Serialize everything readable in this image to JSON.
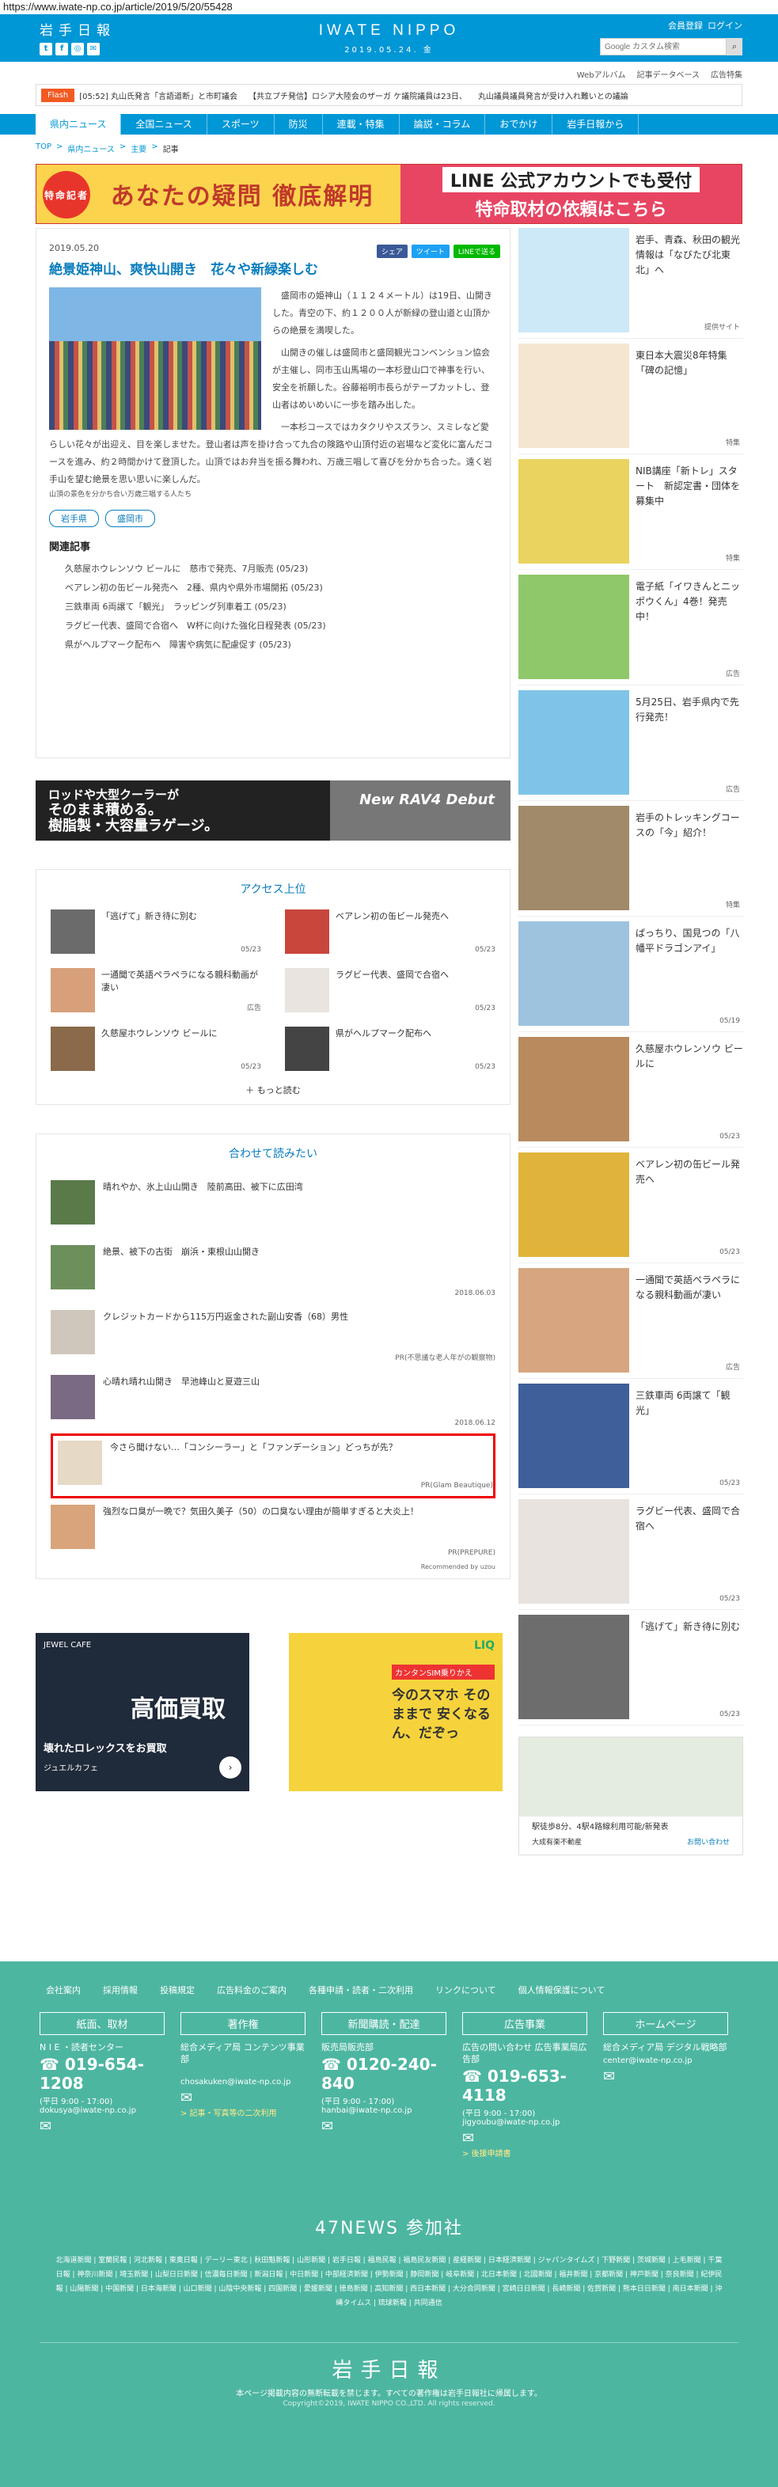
{
  "url": "https://www.iwate-np.co.jp/article/2019/5/20/55428",
  "header": {
    "logo": "岩手日報",
    "brand": "IWATE NIPPO",
    "date": "2019.05.24. 金",
    "register": "会員登録",
    "login": "ログイン",
    "search_placeholder": "Google カスタム検索",
    "social": [
      "t",
      "f",
      "◎",
      "✉"
    ]
  },
  "subnav": [
    "Webアルバム",
    "記事データベース",
    "広告特集"
  ],
  "flash": {
    "badge": "Flash",
    "items": [
      "[05:52] 丸山氏発言「言語道断」と市町議会",
      "【共立プチ発信】ロシア大陸会のザーガ ケ議院議員は23日、",
      "丸山議員議員発言が受け入れ難いとの議論"
    ]
  },
  "gnav": [
    "県内ニュース",
    "全国ニュース",
    "スポーツ",
    "防災",
    "連載・特集",
    "論説・コラム",
    "おでかけ",
    "岩手日報から"
  ],
  "breadcrumb": [
    "TOP",
    "県内ニュース",
    "主要",
    "記事"
  ],
  "banner": {
    "tag": "特命記者",
    "title": "あなたの疑問 徹底解明",
    "line1": "LINE 公式アカウントでも受付",
    "line2": "特命取材の依頼はこちら"
  },
  "article": {
    "date": "2019.05.20",
    "share": [
      "シェア",
      "ツイート",
      "LINEで送る"
    ],
    "title": "絶景姫神山、爽快山開き　花々や新緑楽しむ",
    "caption": "山頂の景色を分かち合い万歳三唱する人たち",
    "paragraphs": [
      "盛岡市の姫神山（１１２４メートル）は19日、山開きした。青空の下、約１２００人が新緑の登山道と山頂からの絶景を満喫した。",
      "山開きの催しは盛岡市と盛岡観光コンベンション協会が主催し、同市玉山馬場の一本杉登山口で神事を行い、安全を祈願した。谷藤裕明市長らがテープカットし、登山者はめいめいに一歩を踏み出した。",
      "一本杉コースではカタクリやスズラン、スミレなど愛らしい花々が出迎え、目を楽しませた。登山者は声を掛け合って九合の険路や山頂付近の岩場など変化に富んだコースを進み、約２時間かけて登頂した。山頂ではお弁当を振る舞われ、万歳三唱して喜びを分かち合った。遠く岩手山を望む絶景を思い思いに楽しんだ。"
    ],
    "tags": [
      "岩手県",
      "盛岡市"
    ],
    "related_title": "関連記事",
    "related": [
      "久慈屋ホウレンソウ ビールに　慈市で発売、7月販売 (05/23)",
      "ベアレン初の缶ビール発売へ　2種、県内や県外市場開拓 (05/23)",
      "三鉄車両 6両譲て「観光」　ラッピング列車着工 (05/23)",
      "ラグビー代表、盛岡で合宿へ　W杯に向けた強化日程発表 (05/23)",
      "県がヘルプマーク配布へ　障害や病気に配慮促す (05/23)"
    ]
  },
  "adwide": {
    "text1": "ロッドや大型クーラーが",
    "text2": "そのまま積める。",
    "text3": "樹脂製・大容量ラゲージ。",
    "brand": "New RAV4 Debut"
  },
  "ranking": {
    "title": "アクセス上位",
    "items": [
      {
        "title": "「逃げて」新き待に別む",
        "meta": "05/23"
      },
      {
        "title": "ベアレン初の缶ビール発売へ",
        "meta": "05/23"
      },
      {
        "title": "一通聞で英語ペラペラになる親科動画が凄い",
        "meta": "広告"
      },
      {
        "title": "ラグビー代表、盛岡で合宿へ",
        "meta": "05/23"
      },
      {
        "title": "久慈屋ホウレンソウ ビールに",
        "meta": "05/23"
      },
      {
        "title": "県がヘルプマーク配布へ",
        "meta": "05/23"
      }
    ],
    "more": "もっと読む"
  },
  "also": {
    "title": "合わせて読みたい",
    "items": [
      {
        "title": "晴れやか、氷上山山開き　陸前高田、被下に広田湾",
        "meta": ""
      },
      {
        "title": "絶景、被下の古街　崩浜・東根山山開き",
        "meta": "2018.06.03"
      },
      {
        "title": "クレジットカードから115万円返金された副山安香（68）男性",
        "meta": "PR(不思議な老人年がの観察物)"
      },
      {
        "title": "心晴れ晴れ山開き　早池峰山と夏遊三山",
        "meta": "2018.06.12"
      },
      {
        "title": "今さら聞けない…「コンシーラー」と「ファンデーション」どっちが先？",
        "meta": "PR(Glam Beautique)"
      },
      {
        "title": "強烈な口臭が一晩で？気田久美子（50）の口臭ない理由が簡単すぎると大炎上！",
        "meta": "PR(PREPURE)"
      }
    ],
    "powered": "Recommended by uzou"
  },
  "bottom_ads": [
    {
      "t1": "JEWEL CAFE",
      "t2": "高価買取",
      "t3": "壊れたロレックスをお買取",
      "t4": "ジュエルカフェ"
    },
    {
      "t1": "カンタンSIM乗りかえ",
      "t2": "今のスマホ そのままで 安くなるん、だぞっ",
      "t3": "LIQ"
    }
  ],
  "side": [
    {
      "title": "岩手、青森、秋田の観光情報は「なびたび北東北」へ",
      "meta": "提供サイト"
    },
    {
      "title": "東日本大震災8年特集「碑の記憶」",
      "meta": "特集"
    },
    {
      "title": "NIB講座「新トレ」スタート　新認定書・団体を募集中",
      "meta": "特集"
    },
    {
      "title": "電子紙「イワきんとニッポウくん」4巻！発売中！",
      "meta": "広告"
    },
    {
      "title": "5月25日、岩手県内で先行発売！",
      "meta": "広告"
    },
    {
      "title": "岩手のトレッキングコースの「今」紹介！",
      "meta": "特集"
    },
    {
      "title": "ぱっちり、国見つの「八幡平ドラゴンアイ」",
      "meta": "05/19"
    },
    {
      "title": "久慈屋ホウレンソウ ビールに",
      "meta": "05/23"
    },
    {
      "title": "ベアレン初の缶ビール発売へ",
      "meta": "05/23"
    },
    {
      "title": "一通聞で英語ペラペラになる親科動画が凄い",
      "meta": "広告"
    },
    {
      "title": "三鉄車両 6両譲て「観光」",
      "meta": "05/23"
    },
    {
      "title": "ラグビー代表、盛岡で合宿へ",
      "meta": "05/23"
    },
    {
      "title": "「逃げて」新き待に別む",
      "meta": "05/23"
    }
  ],
  "side_map": {
    "text": "駅徒歩8分、4駅4路線利用可能/新発表",
    "brand": "大成有楽不動産",
    "link": "お問い合わせ"
  },
  "footer": {
    "links": [
      "会社案内",
      "採用情報",
      "投稿規定",
      "広告料金のご案内",
      "各種申請・読者・二次利用",
      "リンクについて",
      "個人情報保護について"
    ],
    "cols": [
      {
        "h": "紙面、取材",
        "l": "N I E ・読者センター",
        "tel": "019-654-1208",
        "s": "(平日 9:00 - 17:00)",
        "mail": "dokusya@iwate-np.co.jp",
        "y": ""
      },
      {
        "h": "著作権",
        "l": "総合メディア局 コンテンツ事業部",
        "tel": "",
        "s": "",
        "mail": "chosakuken@iwate-np.co.jp",
        "y": "> 記事・写真等の二次利用"
      },
      {
        "h": "新聞購読・配達",
        "l": "販売局販売部",
        "tel": "0120-240-840",
        "s": "(平日 9:00 - 17:00)",
        "mail": "hanbai@iwate-np.co.jp",
        "y": ""
      },
      {
        "h": "広告事業",
        "l": "広告の問い合わせ 広告事業局広告部",
        "tel": "019-653-4118",
        "s": "(平日 9:00 - 17:00)",
        "mail": "jigyoubu@iwate-np.co.jp",
        "y": "> 後援申請書"
      },
      {
        "h": "ホームページ",
        "l": "総合メディア局 デジタル戦略部",
        "tel": "",
        "s": "",
        "mail": "center@iwate-np.co.jp",
        "y": ""
      }
    ],
    "news47": "47NEWS 参加社",
    "papers": "北海道新聞 | 室蘭民報 | 河北新報 | 東奥日報 | デーリー東北 | 秋田魁新報 | 山形新聞 | 岩手日報 | 福島民報 | 福島民友新聞 | 産経新聞 | 日本経済新聞 | ジャパンタイムズ | 下野新聞 | 茨城新聞 | 上毛新聞 | 千葉日報 | 神奈川新聞 | 埼玉新聞 | 山梨日日新聞 | 信濃毎日新聞 | 新潟日報 | 中日新聞 | 中部経済新聞 | 伊勢新聞 | 静岡新聞 | 岐阜新聞 | 北日本新聞 | 北國新聞 | 福井新聞 | 京都新聞 | 神戸新聞 | 奈良新聞 | 紀伊民報 | 山陽新聞 | 中国新聞 | 日本海新聞 | 山口新聞 | 山陰中央新報 | 四国新聞 | 愛媛新聞 | 徳島新聞 | 高知新聞 | 西日本新聞 | 大分合同新聞 | 宮崎日日新聞 | 長崎新聞 | 佐賀新聞 | 熊本日日新聞 | 南日本新聞 | 沖縄タイムス | 琉球新報 | 共同通信",
    "logo": "岩手日報",
    "note": "本ページ掲載内容の無断転載を禁じます。すべての著作権は岩手日報社に帰属します。",
    "copy": "Copyright©2019, IWATE NIPPO CO.,LTD. All rights reserved."
  }
}
